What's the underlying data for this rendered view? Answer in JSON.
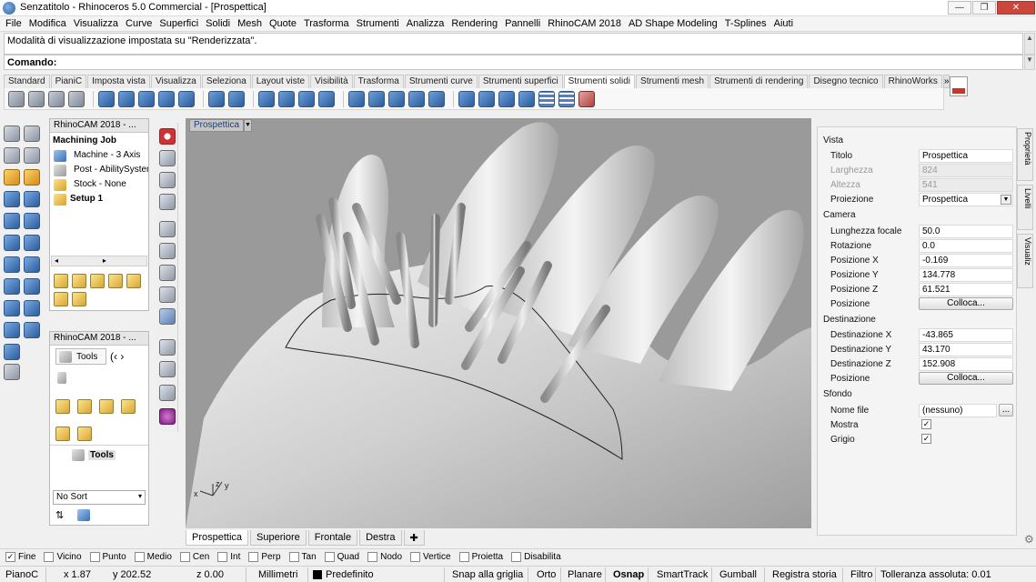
{
  "window": {
    "title": "Senzatitolo - Rhinoceros 5.0 Commercial - [Prospettica]",
    "controls": [
      "minimize",
      "restore",
      "close"
    ]
  },
  "menu": [
    "File",
    "Modifica",
    "Visualizza",
    "Curve",
    "Superfici",
    "Solidi",
    "Mesh",
    "Quote",
    "Trasforma",
    "Strumenti",
    "Analizza",
    "Rendering",
    "Pannelli",
    "RhinoCAM 2018",
    "AD Shape Modeling",
    "T-Splines",
    "Aiuti"
  ],
  "command": {
    "history": "Modalità di visualizzazione impostata su \"Renderizzata\".",
    "prompt": "Comando:"
  },
  "toolbar_tabs": {
    "tabs": [
      "Standard",
      "PianiC",
      "Imposta vista",
      "Visualizza",
      "Seleziona",
      "Layout viste",
      "Visibilità",
      "Trasforma",
      "Strumenti curve",
      "Strumenti superfici",
      "Strumenti solidi",
      "Strumenti mesh",
      "Strumenti di rendering",
      "Disegno tecnico",
      "RhinoWorks"
    ],
    "active": "Strumenti solidi",
    "more": "»"
  },
  "rhinocam_top": {
    "header": "RhinoCAM 2018 - ...",
    "root": "Machining Job",
    "items": [
      "Machine - 3 Axis",
      "Post - AbilitySystem",
      "Stock - None",
      "Setup 1"
    ]
  },
  "rhinocam_bottom": {
    "header": "RhinoCAM 2018 - ...",
    "tab_label": "Tools",
    "tree_label": "Tools",
    "sort_value": "No Sort"
  },
  "viewport": {
    "name": "Prospettica",
    "axes": {
      "x": "x",
      "y": "y",
      "z": "z"
    }
  },
  "view_tabs": [
    "Prospettica",
    "Superiore",
    "Frontale",
    "Destra"
  ],
  "view_tabs_active": "Prospettica",
  "properties": {
    "vista": {
      "section": "Vista",
      "titolo_label": "Titolo",
      "titolo": "Prospettica",
      "larghezza_label": "Larghezza",
      "larghezza": "824",
      "altezza_label": "Altezza",
      "altezza": "541",
      "proiezione_label": "Proiezione",
      "proiezione": "Prospettica"
    },
    "camera": {
      "section": "Camera",
      "lunghezza_label": "Lunghezza focale",
      "lunghezza": "50.0",
      "rotazione_label": "Rotazione",
      "rotazione": "0.0",
      "posx_label": "Posizione X",
      "posx": "-0.169",
      "posy_label": "Posizione Y",
      "posy": "134.778",
      "posz_label": "Posizione Z",
      "posz": "61.521",
      "pos_label": "Posizione",
      "pos_button": "Colloca..."
    },
    "destinazione": {
      "section": "Destinazione",
      "dx_label": "Destinazione X",
      "dx": "-43.865",
      "dy_label": "Destinazione Y",
      "dy": "43.170",
      "dz_label": "Destinazione Z",
      "dz": "152.908",
      "pos_label": "Posizione",
      "pos_button": "Colloca..."
    },
    "sfondo": {
      "section": "Sfondo",
      "file_label": "Nome file",
      "file": "(nessuno)",
      "file_button": "...",
      "mostra_label": "Mostra",
      "mostra": true,
      "grigio_label": "Grigio",
      "grigio": true
    }
  },
  "side_tabs": [
    "Proprietà",
    "Livelli",
    "Visualiz"
  ],
  "osnap": [
    {
      "label": "Fine",
      "checked": true
    },
    {
      "label": "Vicino",
      "checked": false
    },
    {
      "label": "Punto",
      "checked": false
    },
    {
      "label": "Medio",
      "checked": false
    },
    {
      "label": "Cen",
      "checked": false
    },
    {
      "label": "Int",
      "checked": false
    },
    {
      "label": "Perp",
      "checked": false
    },
    {
      "label": "Tan",
      "checked": false
    },
    {
      "label": "Quad",
      "checked": false
    },
    {
      "label": "Nodo",
      "checked": false
    },
    {
      "label": "Vertice",
      "checked": false
    },
    {
      "label": "Proietta",
      "checked": false
    },
    {
      "label": "Disabilita",
      "checked": false
    }
  ],
  "status": {
    "cplane": "PianoC",
    "x": "x 1.87",
    "y": "y 202.52",
    "z": "z 0.00",
    "units": "Millimetri",
    "layer": "Predefinito",
    "toggles": [
      "Snap alla griglia",
      "Orto",
      "Planare",
      "Osnap",
      "SmartTrack",
      "Gumball",
      "Registra storia",
      "Filtro"
    ],
    "bold_toggle": "Osnap",
    "tolerance": "Tolleranza assoluta: 0.01"
  },
  "colors": {
    "viewport_bg": "#9a9a9a",
    "active_tab": "#ffffff",
    "layer_swatch": "#000000"
  }
}
